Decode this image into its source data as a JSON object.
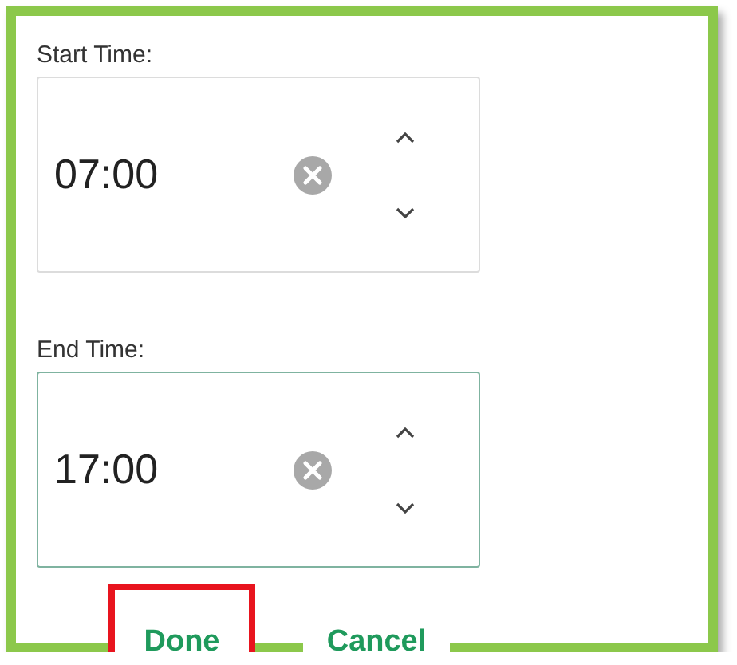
{
  "fields": [
    {
      "label": "Start Time:",
      "value": "07:00",
      "focused": false
    },
    {
      "label": "End Time:",
      "value": "17:00",
      "focused": true
    }
  ],
  "buttons": [
    {
      "label": "Done",
      "highlighted": true
    },
    {
      "label": "Cancel",
      "highlighted": false
    }
  ]
}
